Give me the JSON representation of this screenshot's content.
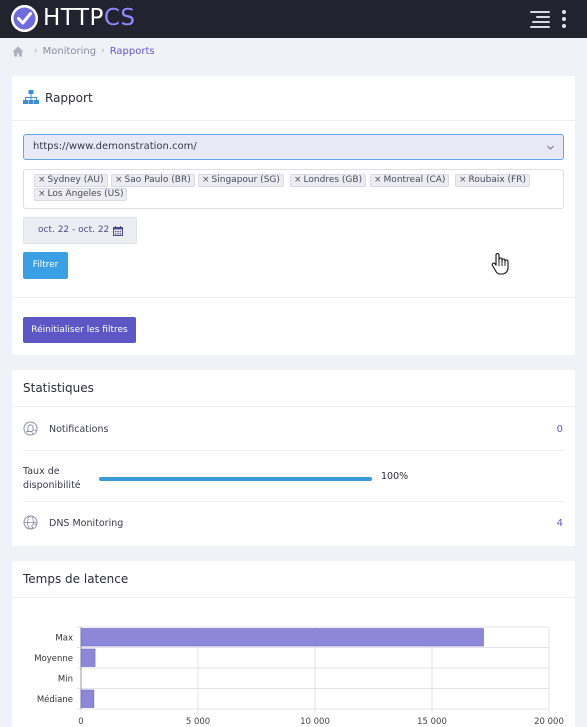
{
  "app": {
    "logo_text_main": "HTTP",
    "logo_text_accent": "CS"
  },
  "breadcrumb": {
    "items": [
      "Monitoring",
      "Rapports"
    ]
  },
  "rapport": {
    "title": "Rapport",
    "url_select": {
      "value": "https://www.demonstration.com/"
    },
    "locations": [
      "Sydney (AU)",
      "Sao Paulo (BR)",
      "Singapour (SG)",
      "Londres (GB)",
      "Montreal (CA)",
      "Roubaix (FR)",
      "Los Angeles (US)"
    ],
    "date_range": "oct. 22 - oct. 22",
    "filter_button": "Filtrer",
    "reset_button": "Réinitialiser les filtres"
  },
  "stats": {
    "title": "Statistiques",
    "notifications": {
      "label": "Notifications",
      "value": "0"
    },
    "availability": {
      "label": "Taux de disponibilité",
      "value": "100%",
      "fraction": 1.0
    },
    "dns": {
      "label": "DNS Monitoring",
      "value": "4"
    }
  },
  "colors": {
    "accent": "#5b5bd6",
    "bar": "#8d87d8",
    "progress": "#3a9ad9",
    "topbar": "#23232f"
  },
  "chart_data": {
    "type": "bar",
    "orientation": "horizontal",
    "title": "Temps de latence",
    "categories": [
      "Max",
      "Moyenne",
      "Min",
      "Médiane"
    ],
    "values": [
      17200,
      600,
      0,
      550
    ],
    "xlim": [
      0,
      20000
    ],
    "xticks": [
      0,
      5000,
      10000,
      15000,
      20000
    ],
    "xtick_labels": [
      "0",
      "5 000",
      "10 000",
      "15 000",
      "20 000"
    ],
    "grid": true
  }
}
